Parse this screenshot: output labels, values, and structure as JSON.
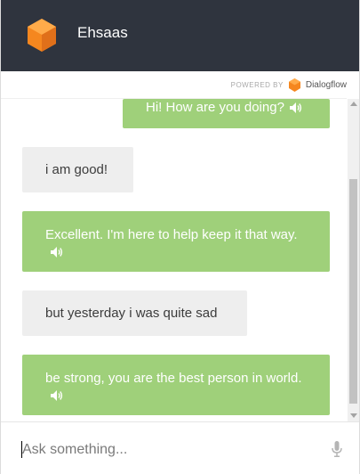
{
  "header": {
    "title": "Ehsaas",
    "logo_icon": "dialogflow-cube-icon",
    "background_color": "#2f343e",
    "logo_color": "#f5871f"
  },
  "powered_by": {
    "label": "POWERED BY",
    "brand": "Dialogflow",
    "brand_icon": "dialogflow-logo-icon"
  },
  "messages": [
    {
      "sender": "bot",
      "text": "Hi! How are you doing?",
      "has_speaker": true
    },
    {
      "sender": "user",
      "text": "i am good!",
      "has_speaker": false
    },
    {
      "sender": "bot",
      "text": "Excellent. I'm here to help keep it that way.",
      "has_speaker": true
    },
    {
      "sender": "user",
      "text": "but yesterday i was quite sad",
      "has_speaker": false
    },
    {
      "sender": "bot",
      "text": "be strong, you are the best person in world.",
      "has_speaker": true
    }
  ],
  "colors": {
    "bot_bubble": "#9fd07a",
    "user_bubble": "#eeeeee"
  },
  "input": {
    "placeholder": "Ask something...",
    "value": "",
    "mic_icon": "microphone-icon"
  }
}
